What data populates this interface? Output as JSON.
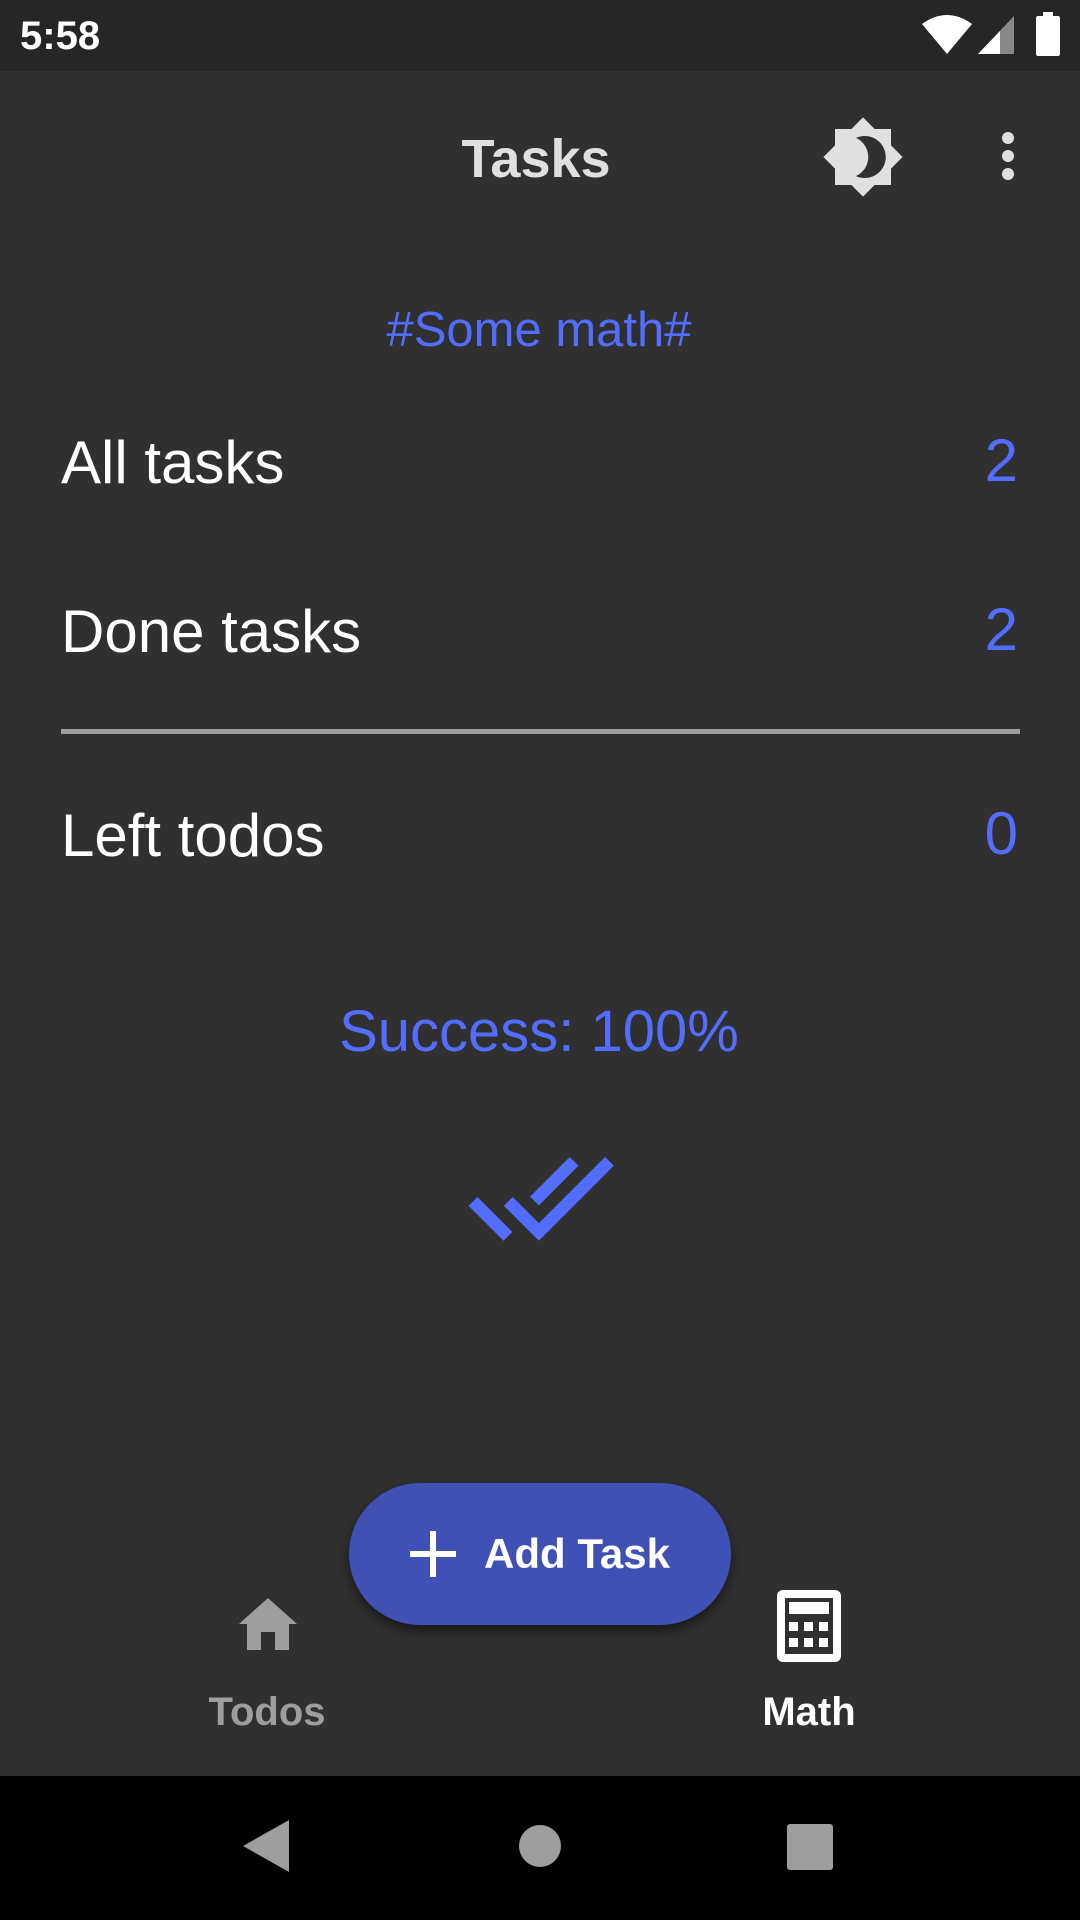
{
  "status_bar": {
    "time": "5:58"
  },
  "app_bar": {
    "title": "Tasks",
    "theme_icon": "brightness-icon",
    "menu_icon": "more-vert-icon"
  },
  "main": {
    "subtitle": "#Some math#",
    "rows": [
      {
        "label": "All tasks",
        "value": "2"
      },
      {
        "label": "Done tasks",
        "value": "2"
      },
      {
        "label": "Left todos",
        "value": "0"
      }
    ],
    "success": "Success: 100%",
    "accent": "#536dfe"
  },
  "fab": {
    "label": "Add Task",
    "color": "#3f51b5"
  },
  "bottom_nav": {
    "items": [
      {
        "label": "Todos",
        "icon": "home-icon",
        "active": false
      },
      {
        "label": "Math",
        "icon": "calculator-icon",
        "active": true
      }
    ]
  }
}
